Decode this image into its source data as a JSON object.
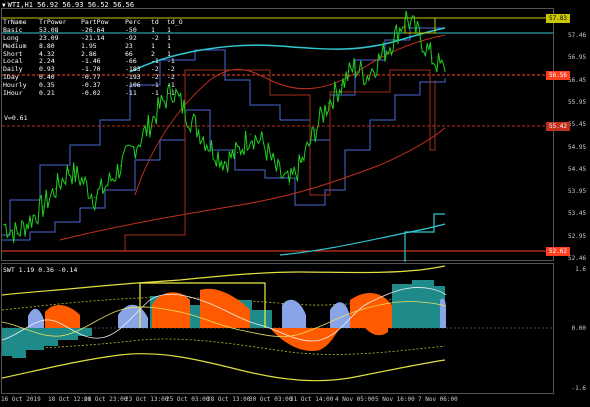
{
  "chart_header": {
    "symbol_line": "WTI,H1  56.92 56.93 56.52 56.56"
  },
  "table": {
    "headers": [
      "TrName",
      "TrPower",
      "PartPow",
      "Perc",
      "td",
      "td_O"
    ],
    "rows": [
      [
        "Basic",
        "53.08",
        "-26.64",
        "-50",
        "1",
        "1"
      ],
      [
        "Long",
        "23.09",
        "-21.14",
        "-92",
        "-2",
        "1"
      ],
      [
        "Medium",
        "8.80",
        "1.95",
        "23",
        "1",
        "1"
      ],
      [
        "Short",
        "4.32",
        "2.86",
        "66",
        "2",
        "1"
      ],
      [
        "Local",
        "2.24",
        "-1.46",
        "-66",
        "-1",
        "-1"
      ],
      [
        "Daily",
        "0.93",
        "-1.70",
        "-183",
        "-2",
        "-2"
      ],
      [
        "IDay",
        "0.40",
        "-0.77",
        "-193",
        "-2",
        "-2"
      ],
      [
        "Hourly",
        "0.35",
        "-0.37",
        "-106",
        "-1",
        "-1"
      ],
      [
        "IHour",
        "0.21",
        "-0.02",
        "-11",
        "-1",
        "-1"
      ]
    ],
    "v_line": "V=0.61"
  },
  "price_axis": {
    "labels": [
      "57.46",
      "56.95",
      "56.45",
      "55.95",
      "55.45",
      "54.95",
      "54.45",
      "53.95",
      "53.45",
      "52.95",
      "52.46"
    ],
    "tag_top": "57.83",
    "tag_current": "56.56",
    "tag_mid": "55.42",
    "tag_bottom": "52.62",
    "tag_colors": {
      "top": "#c8c800",
      "current": "#ff4020",
      "mid": "#c0301a",
      "bottom": "#ff4020"
    }
  },
  "indicator": {
    "title": "SWT 1.19 0.36 -0.14",
    "axis_labels": [
      "1.6",
      "0.00",
      "-1.6"
    ]
  },
  "time_axis": [
    "16 Oct 2019",
    "18 Oct 12:00",
    "21 Oct 23:00",
    "23 Oct 13:00",
    "25 Oct 03:00",
    "28 Oct 13:00",
    "30 Oct 03:00",
    "31 Oct 14:00",
    "4 Nov 05:00",
    "5 Nov 16:00",
    "7 Nov 06:00"
  ],
  "chart_data": {
    "type": "line",
    "series": [
      {
        "values": [
          53.2,
          53.0,
          53.3,
          53.6,
          54.0,
          54.4,
          54.2,
          53.8,
          54.1,
          54.5,
          54.9,
          55.3,
          55.8,
          56.2,
          55.7,
          55.3,
          54.9,
          54.6,
          54.8,
          55.2,
          55.0,
          54.4,
          54.1,
          54.6,
          55.3,
          55.9,
          56.3,
          56.7,
          56.5,
          56.9,
          57.3,
          57.8,
          57.4,
          56.9,
          56.6
        ]
      }
    ]
  }
}
